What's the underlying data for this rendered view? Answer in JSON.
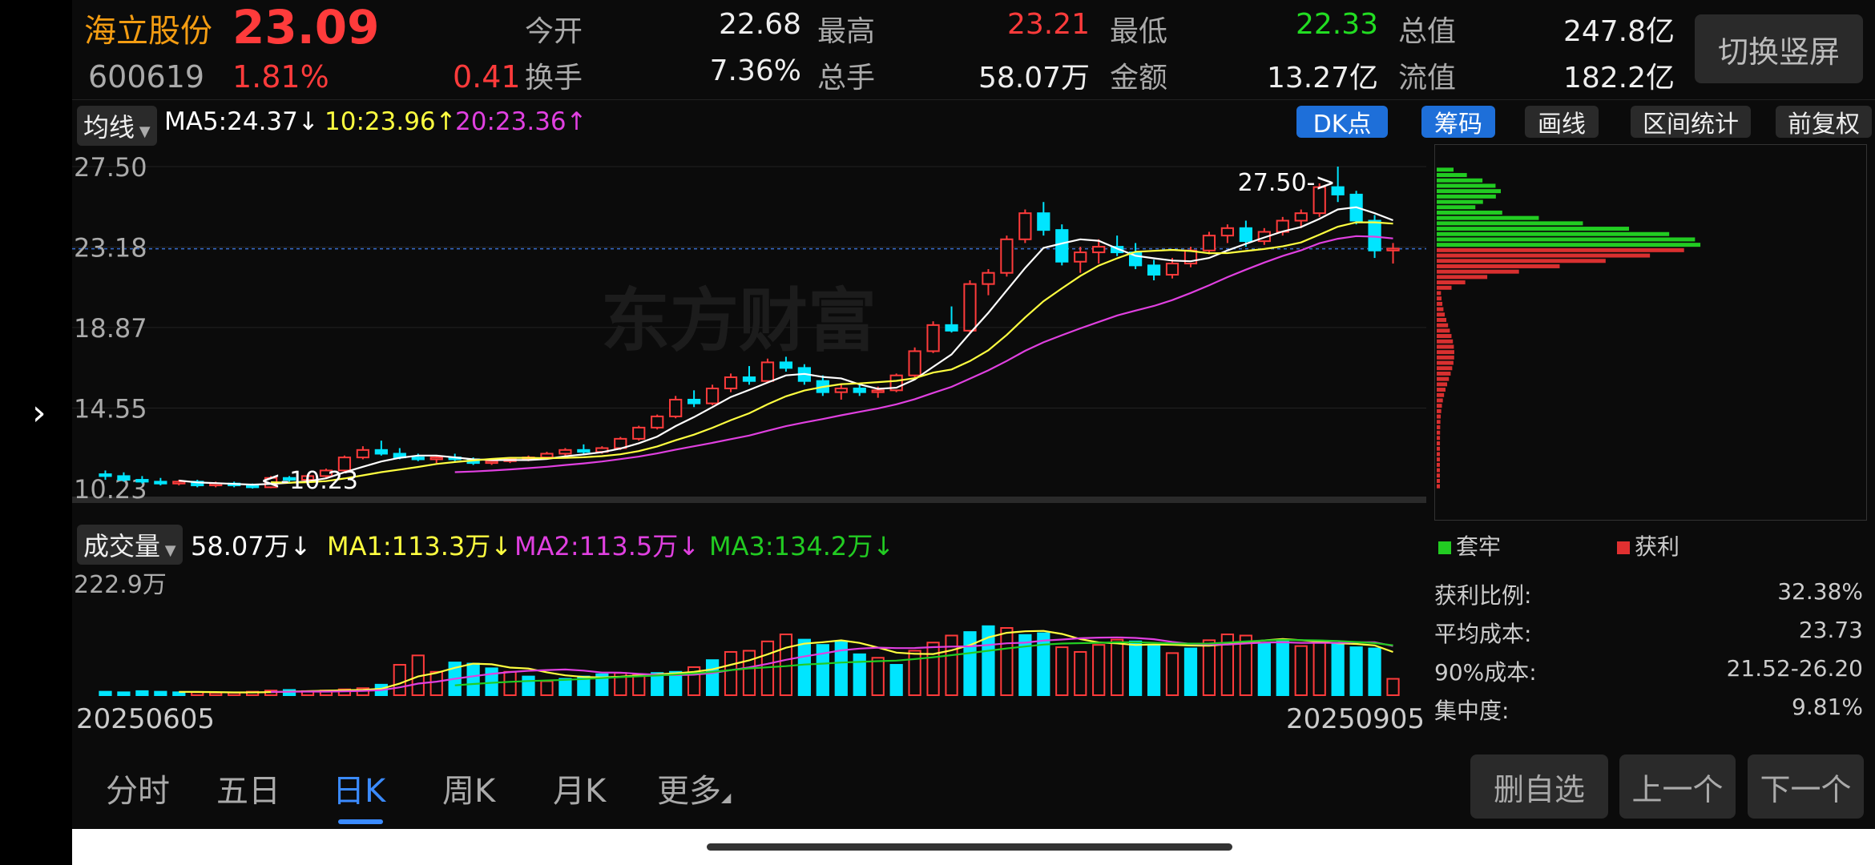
{
  "stock": {
    "name": "海立股份",
    "price": "23.09",
    "code": "600619",
    "pct": "1.81%",
    "change": "0.41"
  },
  "quote": {
    "open_label": "今开",
    "open": "22.68",
    "high_label": "最高",
    "high": "23.21",
    "low_label": "最低",
    "low": "22.33",
    "mktcap_label": "总值",
    "mktcap": "247.8亿",
    "turnover_label": "换手",
    "turnover": "7.36%",
    "vol_label": "总手",
    "vol": "58.07万",
    "amount_label": "金额",
    "amount": "13.27亿",
    "float_label": "流值",
    "float": "182.2亿"
  },
  "switch_button": "切换竖屏",
  "ma_bar": {
    "selector": "均线",
    "ma5": "MA5:24.37",
    "ma10": "10:23.96",
    "ma20": "20:23.36"
  },
  "toolbar": {
    "dk": "DK点",
    "chips": "筹码",
    "draw": "画线",
    "range": "区间统计",
    "adjust": "前复权"
  },
  "axis": {
    "y1": "27.50",
    "y2": "23.18",
    "y3": "18.87",
    "y4": "14.55",
    "y5": "10.23",
    "high_mark": "27.50->",
    "low_mark": "<-10.23"
  },
  "watermark": "东方财富",
  "volume_bar": {
    "selector": "成交量",
    "vol": "58.07万",
    "ma1": "MA1:113.3万",
    "ma2": "MA2:113.5万",
    "ma3": "MA3:134.2万",
    "vmax": "222.9万"
  },
  "dates": {
    "start": "20250605",
    "end": "20250905"
  },
  "dist_legend": {
    "trapped": "套牢",
    "profit": "获利"
  },
  "stats": {
    "ratio_label": "获利比例:",
    "ratio": "32.38%",
    "avg_label": "平均成本:",
    "avg": "23.73",
    "c90_label": "90%成本:",
    "c90": "21.52-26.20",
    "conc_label": "集中度:",
    "conc": "9.81%"
  },
  "tabs": [
    "分时",
    "五日",
    "日K",
    "周K",
    "月K",
    "更多"
  ],
  "bottom_buttons": {
    "remove": "删自选",
    "prev": "上一个",
    "next": "下一个"
  },
  "colors": {
    "up": "#ff3b3b",
    "down": "#00e5ff",
    "ma5": "#ffffff",
    "ma10": "#ffff40",
    "ma20": "#e040e0",
    "green": "#22cc22"
  },
  "chart_data": {
    "type": "candlestick",
    "title": "",
    "ylim": [
      10.23,
      27.5
    ],
    "ohlc": [
      [
        11.0,
        11.2,
        10.7,
        10.9
      ],
      [
        10.9,
        11.1,
        10.6,
        10.7
      ],
      [
        10.7,
        10.9,
        10.5,
        10.6
      ],
      [
        10.6,
        10.8,
        10.4,
        10.5
      ],
      [
        10.5,
        10.7,
        10.4,
        10.6
      ],
      [
        10.6,
        10.7,
        10.3,
        10.4
      ],
      [
        10.4,
        10.6,
        10.3,
        10.5
      ],
      [
        10.5,
        10.6,
        10.3,
        10.4
      ],
      [
        10.4,
        10.5,
        10.23,
        10.3
      ],
      [
        10.3,
        10.9,
        10.25,
        10.8
      ],
      [
        10.8,
        10.9,
        10.6,
        10.7
      ],
      [
        10.7,
        11.0,
        10.6,
        10.9
      ],
      [
        10.9,
        11.3,
        10.8,
        11.2
      ],
      [
        11.2,
        12.0,
        11.1,
        11.9
      ],
      [
        11.9,
        12.5,
        11.8,
        12.3
      ],
      [
        12.3,
        12.8,
        12.0,
        12.1
      ],
      [
        12.1,
        12.4,
        11.8,
        11.9
      ],
      [
        11.9,
        12.1,
        11.7,
        11.8
      ],
      [
        11.8,
        12.0,
        11.6,
        11.9
      ],
      [
        11.9,
        12.1,
        11.7,
        11.8
      ],
      [
        11.8,
        11.9,
        11.5,
        11.6
      ],
      [
        11.6,
        11.8,
        11.5,
        11.7
      ],
      [
        11.7,
        11.9,
        11.6,
        11.8
      ],
      [
        11.8,
        12.0,
        11.7,
        11.9
      ],
      [
        11.9,
        12.2,
        11.8,
        12.1
      ],
      [
        12.1,
        12.4,
        12.0,
        12.3
      ],
      [
        12.3,
        12.6,
        12.1,
        12.2
      ],
      [
        12.2,
        12.5,
        12.1,
        12.4
      ],
      [
        12.4,
        13.0,
        12.3,
        12.9
      ],
      [
        12.9,
        13.6,
        12.8,
        13.5
      ],
      [
        13.5,
        14.2,
        13.4,
        14.1
      ],
      [
        14.1,
        15.2,
        14.0,
        15.0
      ],
      [
        15.0,
        15.5,
        14.6,
        14.8
      ],
      [
        14.8,
        15.8,
        14.7,
        15.6
      ],
      [
        15.6,
        16.4,
        15.4,
        16.2
      ],
      [
        16.2,
        16.8,
        15.8,
        16.0
      ],
      [
        16.0,
        17.2,
        15.9,
        17.0
      ],
      [
        17.0,
        17.3,
        16.5,
        16.7
      ],
      [
        16.7,
        16.9,
        15.8,
        16.0
      ],
      [
        16.0,
        16.3,
        15.2,
        15.4
      ],
      [
        15.4,
        15.8,
        15.0,
        15.6
      ],
      [
        15.6,
        15.9,
        15.2,
        15.4
      ],
      [
        15.4,
        15.7,
        15.1,
        15.5
      ],
      [
        15.5,
        16.4,
        15.4,
        16.3
      ],
      [
        16.3,
        17.8,
        16.2,
        17.6
      ],
      [
        17.6,
        19.2,
        17.5,
        19.0
      ],
      [
        19.0,
        20.0,
        18.6,
        18.7
      ],
      [
        18.7,
        21.4,
        18.6,
        21.2
      ],
      [
        21.2,
        22.0,
        20.6,
        21.8
      ],
      [
        21.8,
        23.8,
        21.6,
        23.6
      ],
      [
        23.6,
        25.2,
        23.4,
        25.0
      ],
      [
        25.0,
        25.6,
        23.8,
        24.1
      ],
      [
        24.1,
        24.4,
        22.2,
        22.4
      ],
      [
        22.4,
        23.2,
        21.8,
        22.9
      ],
      [
        22.9,
        23.6,
        22.3,
        23.2
      ],
      [
        23.2,
        23.8,
        22.7,
        22.9
      ],
      [
        22.9,
        23.4,
        22.0,
        22.2
      ],
      [
        22.2,
        22.5,
        21.4,
        21.7
      ],
      [
        21.7,
        22.6,
        21.5,
        22.3
      ],
      [
        22.3,
        23.2,
        22.1,
        23.0
      ],
      [
        23.0,
        24.0,
        22.8,
        23.8
      ],
      [
        23.8,
        24.4,
        23.4,
        24.2
      ],
      [
        24.2,
        24.6,
        23.2,
        23.5
      ],
      [
        23.5,
        24.2,
        23.3,
        24.0
      ],
      [
        24.0,
        24.8,
        23.8,
        24.6
      ],
      [
        24.6,
        25.2,
        24.2,
        25.0
      ],
      [
        25.0,
        26.6,
        24.8,
        26.4
      ],
      [
        26.4,
        27.5,
        25.6,
        26.0
      ],
      [
        26.0,
        26.2,
        24.4,
        24.6
      ],
      [
        24.6,
        24.9,
        22.6,
        23.0
      ],
      [
        23.0,
        23.4,
        22.3,
        23.1
      ]
    ],
    "volumes": [
      [
        6,
        1
      ],
      [
        5,
        1
      ],
      [
        7,
        1
      ],
      [
        6,
        1
      ],
      [
        5,
        1
      ],
      [
        5,
        0
      ],
      [
        4,
        0
      ],
      [
        4,
        0
      ],
      [
        6,
        0
      ],
      [
        8,
        0
      ],
      [
        9,
        1
      ],
      [
        7,
        0
      ],
      [
        8,
        0
      ],
      [
        10,
        0
      ],
      [
        12,
        0
      ],
      [
        18,
        1
      ],
      [
        52,
        0
      ],
      [
        68,
        0
      ],
      [
        40,
        0
      ],
      [
        56,
        1
      ],
      [
        54,
        1
      ],
      [
        46,
        1
      ],
      [
        40,
        0
      ],
      [
        32,
        1
      ],
      [
        24,
        0
      ],
      [
        28,
        1
      ],
      [
        32,
        1
      ],
      [
        36,
        1
      ],
      [
        38,
        0
      ],
      [
        35,
        0
      ],
      [
        38,
        1
      ],
      [
        40,
        1
      ],
      [
        48,
        0
      ],
      [
        60,
        1
      ],
      [
        74,
        0
      ],
      [
        76,
        0
      ],
      [
        92,
        0
      ],
      [
        104,
        0
      ],
      [
        95,
        1
      ],
      [
        86,
        1
      ],
      [
        92,
        1
      ],
      [
        70,
        1
      ],
      [
        64,
        0
      ],
      [
        52,
        1
      ],
      [
        76,
        0
      ],
      [
        90,
        0
      ],
      [
        102,
        0
      ],
      [
        108,
        1
      ],
      [
        118,
        1
      ],
      [
        115,
        0
      ],
      [
        103,
        1
      ],
      [
        106,
        1
      ],
      [
        82,
        0
      ],
      [
        74,
        0
      ],
      [
        86,
        0
      ],
      [
        95,
        0
      ],
      [
        92,
        1
      ],
      [
        86,
        1
      ],
      [
        72,
        0
      ],
      [
        80,
        1
      ],
      [
        94,
        0
      ],
      [
        104,
        0
      ],
      [
        102,
        0
      ],
      [
        88,
        1
      ],
      [
        92,
        1
      ],
      [
        84,
        0
      ],
      [
        92,
        0
      ],
      [
        88,
        1
      ],
      [
        82,
        1
      ],
      [
        80,
        1
      ],
      [
        28,
        0
      ]
    ],
    "vmax": 222.9
  }
}
